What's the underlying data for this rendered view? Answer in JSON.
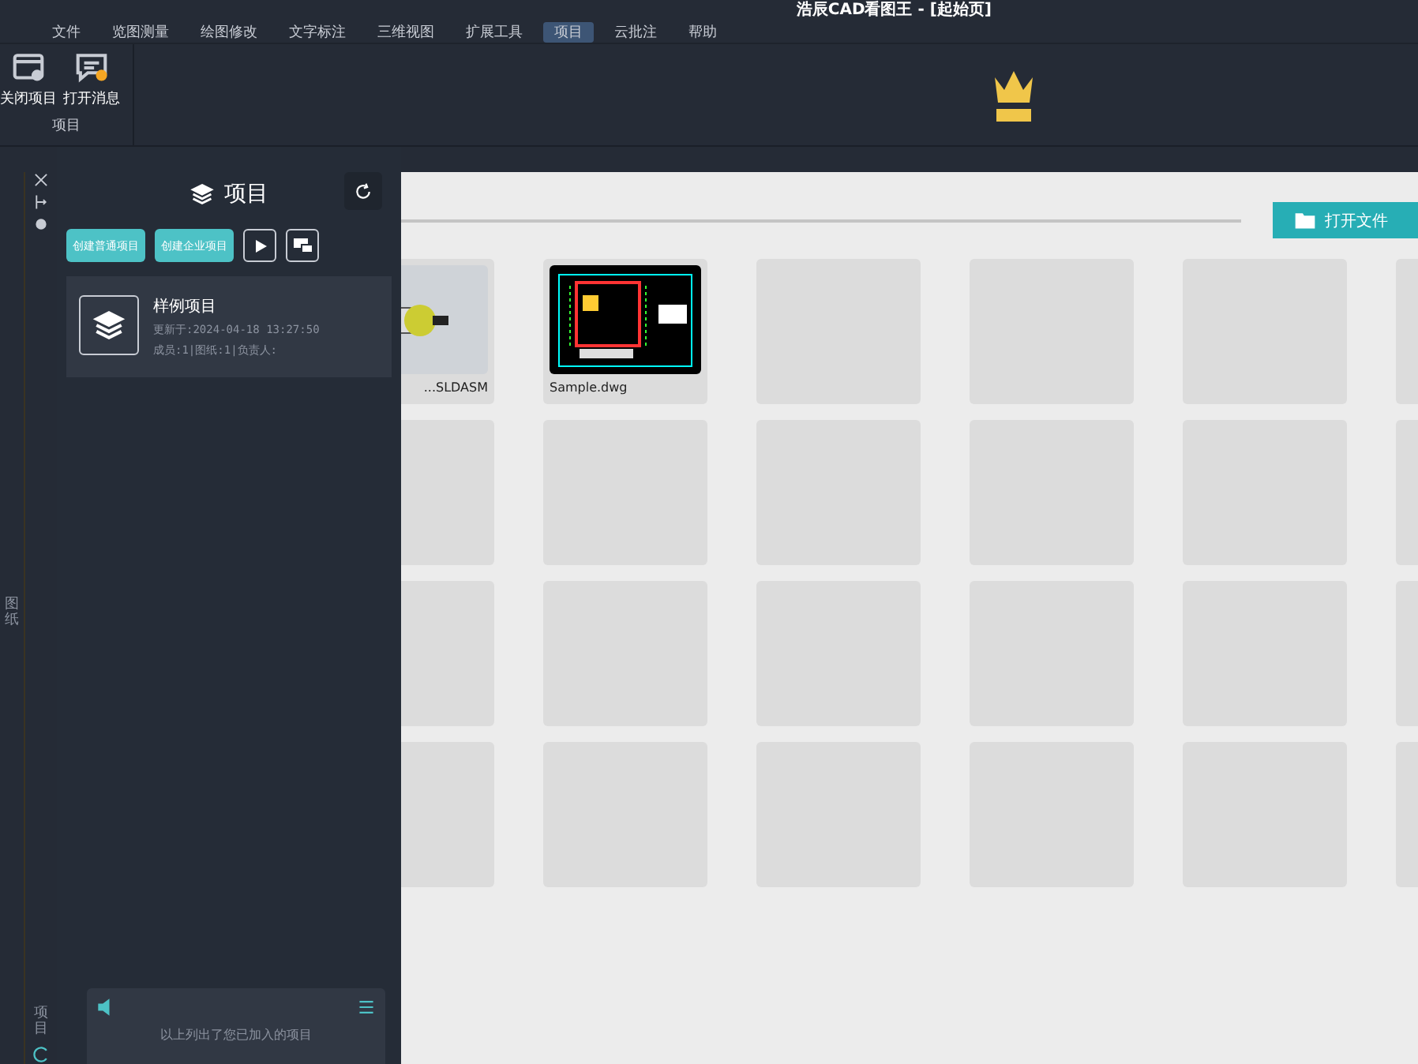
{
  "window": {
    "title": "浩辰CAD看图王 - [起始页]"
  },
  "menu": [
    {
      "label": "文件",
      "selected": false
    },
    {
      "label": "览图测量",
      "selected": false
    },
    {
      "label": "绘图修改",
      "selected": false
    },
    {
      "label": "文字标注",
      "selected": false
    },
    {
      "label": "三维视图",
      "selected": false
    },
    {
      "label": "扩展工具",
      "selected": false
    },
    {
      "label": "项目",
      "selected": true
    },
    {
      "label": "云批注",
      "selected": false
    },
    {
      "label": "帮助",
      "selected": false
    }
  ],
  "ribbon": {
    "buttons": [
      {
        "label": "关闭项目",
        "kind": "close"
      },
      {
        "label": "打开消息",
        "kind": "message"
      }
    ],
    "group_label": "项目"
  },
  "side_tabs": [
    "图纸",
    "项目"
  ],
  "panel": {
    "title": "项目",
    "buttons": [
      "创建普通项目",
      "创建企业项目"
    ],
    "projects": [
      {
        "name": "样例项目",
        "updated": "更新于:2024-04-18 13:27:50",
        "info": "成员:1|图纸:1|负责人:"
      }
    ],
    "footer": "以上列出了您已加入的项目"
  },
  "main": {
    "open_button": "打开文件",
    "files": [
      {
        "name": "...SLDASM",
        "kind": "part"
      },
      {
        "name": "Sample.dwg",
        "kind": "dwg"
      }
    ]
  }
}
